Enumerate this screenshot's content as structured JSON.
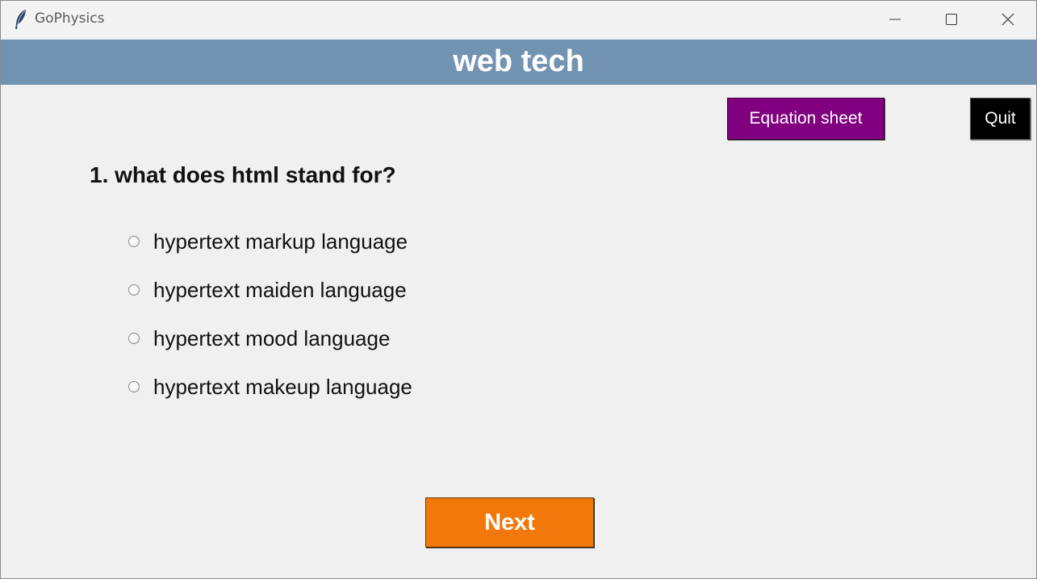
{
  "window": {
    "title": "GoPhysics"
  },
  "header": {
    "title": "web tech",
    "background": "#7393b3"
  },
  "toolbar": {
    "equation_sheet_label": "Equation sheet",
    "equation_sheet_color": "#800080",
    "quit_label": "Quit",
    "quit_color": "#000000"
  },
  "question": {
    "text": "1. what does html stand for?",
    "options": [
      {
        "label": "hypertext markup language",
        "selected": false
      },
      {
        "label": "hypertext maiden language",
        "selected": false
      },
      {
        "label": "hypertext mood language",
        "selected": false
      },
      {
        "label": "hypertext makeup language",
        "selected": false
      }
    ]
  },
  "footer": {
    "next_label": "Next",
    "next_color": "#f2780c"
  },
  "icons": {
    "app": "feather-icon",
    "minimize": "minimize-icon",
    "maximize": "maximize-icon",
    "close": "close-icon"
  }
}
